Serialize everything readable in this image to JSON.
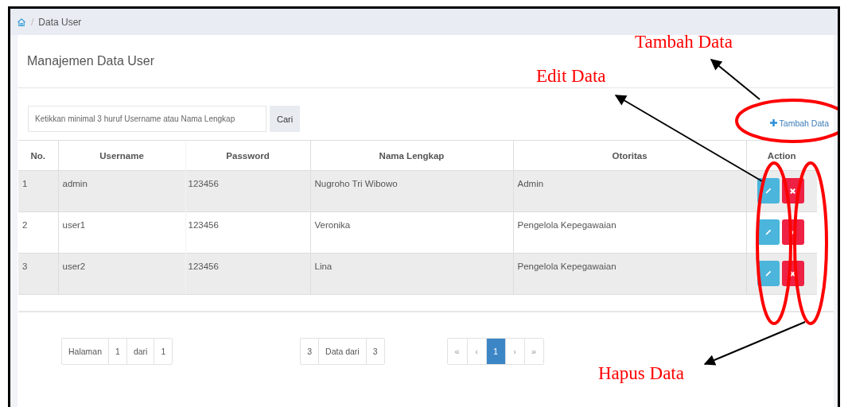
{
  "breadcrumb": {
    "separator": "/",
    "current": "Data User"
  },
  "card": {
    "title": "Manajemen Data User"
  },
  "search": {
    "placeholder": "Ketikkan minimal 3 huruf Username atau Nama Lengkap",
    "button": "Cari"
  },
  "add_link": {
    "label": "Tambah Data"
  },
  "table": {
    "columns": [
      "No.",
      "Username",
      "Password",
      "Nama Lengkap",
      "Otoritas",
      "Action"
    ],
    "rows": [
      {
        "cells": [
          "1",
          "admin",
          "123456",
          "Nugroho Tri Wibowo",
          "Admin"
        ],
        "striped": true
      },
      {
        "cells": [
          "2",
          "user1",
          "123456",
          "Veronika",
          "Pengelola Kepegawaian"
        ],
        "striped": false
      },
      {
        "cells": [
          "3",
          "user2",
          "123456",
          "Lina",
          "Pengelola Kepegawaian"
        ],
        "striped": true
      }
    ]
  },
  "page_info": [
    "Halaman",
    "1",
    "dari",
    "1"
  ],
  "data_info": [
    "3",
    "Data dari",
    "3"
  ],
  "pager": [
    {
      "label": "«",
      "selected": false
    },
    {
      "label": "‹",
      "selected": false
    },
    {
      "label": "1",
      "selected": true
    },
    {
      "label": "›",
      "selected": false
    },
    {
      "label": "»",
      "selected": false
    }
  ],
  "annotations": [
    {
      "kind": "label",
      "text": "Tambah Data"
    },
    {
      "kind": "label",
      "text": "Edit Data"
    },
    {
      "kind": "label",
      "text": "Hapus Data"
    }
  ]
}
